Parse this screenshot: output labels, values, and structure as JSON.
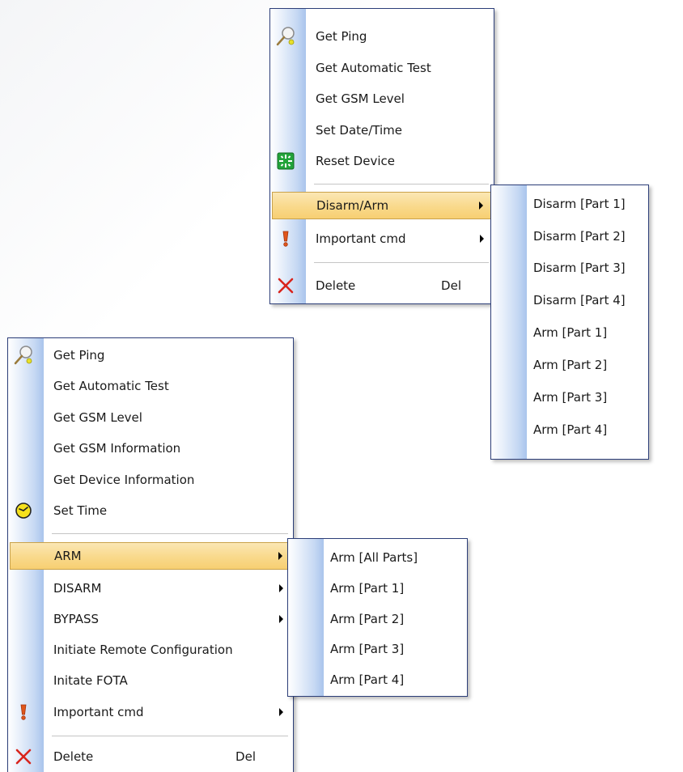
{
  "menu_a": {
    "items": [
      {
        "label": "Get Ping",
        "icon": "racket-icon"
      },
      {
        "label": "Get Automatic Test"
      },
      {
        "label": "Get GSM Level"
      },
      {
        "label": "Set Date/Time"
      },
      {
        "label": "Reset Device",
        "icon": "reset-icon"
      },
      {
        "label": "Disarm/Arm",
        "submenu": true,
        "highlighted": true
      },
      {
        "label": "Important cmd",
        "icon": "exclamation-icon",
        "submenu": true
      },
      {
        "label": "Delete",
        "icon": "delete-x-icon",
        "shortcut": "Del"
      }
    ]
  },
  "submenu_a": {
    "items": [
      "Disarm [Part 1]",
      "Disarm [Part 2]",
      "Disarm [Part 3]",
      "Disarm [Part 4]",
      "Arm [Part 1]",
      "Arm [Part 2]",
      "Arm [Part 3]",
      "Arm [Part 4]"
    ]
  },
  "menu_b": {
    "items": [
      {
        "label": "Get Ping",
        "icon": "racket-icon"
      },
      {
        "label": "Get Automatic Test"
      },
      {
        "label": "Get GSM Level"
      },
      {
        "label": "Get GSM Information"
      },
      {
        "label": "Get Device Information"
      },
      {
        "label": "Set Time",
        "icon": "clock-icon"
      },
      {
        "label": "ARM",
        "submenu": true,
        "highlighted": true
      },
      {
        "label": "DISARM",
        "submenu": true
      },
      {
        "label": "BYPASS",
        "submenu": true
      },
      {
        "label": "Initiate Remote Configuration"
      },
      {
        "label": "Initate FOTA"
      },
      {
        "label": "Important cmd",
        "icon": "exclamation-icon",
        "submenu": true
      },
      {
        "label": "Delete",
        "icon": "delete-x-icon",
        "shortcut": "Del"
      }
    ]
  },
  "submenu_b": {
    "items": [
      "Arm [All Parts]",
      "Arm [Part 1]",
      "Arm [Part 2]",
      "Arm [Part 3]",
      "Arm [Part 4]"
    ]
  },
  "colors": {
    "highlight": "#f9d98b",
    "border": "#2c3e78",
    "gutter": "#c5d8f3",
    "delete_red": "#d9241c",
    "exclamation": "#e0561b",
    "reset_green": "#22a33a",
    "clock_yellow": "#f5e11d"
  }
}
